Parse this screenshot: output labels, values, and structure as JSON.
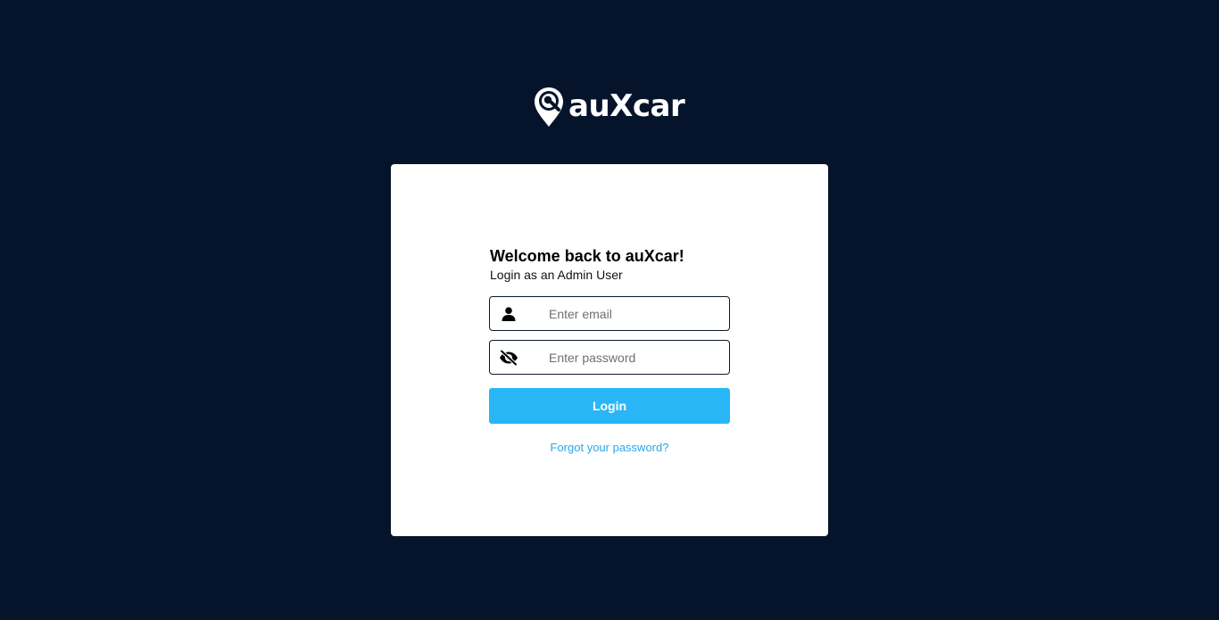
{
  "brand": {
    "name": "auXcar",
    "logo_icon": "location-pin-icon",
    "text_color": "#ffffff"
  },
  "login": {
    "title": "Welcome back to auXcar!",
    "subtitle": "Login as an Admin User",
    "email": {
      "icon": "user-icon",
      "placeholder": "Enter email",
      "value": ""
    },
    "password": {
      "icon": "eye-slash-icon",
      "placeholder": "Enter password",
      "value": ""
    },
    "button_label": "Login",
    "forgot_link": "Forgot your password?"
  },
  "colors": {
    "background": "#06142b",
    "card": "#ffffff",
    "accent": "#29b6f6",
    "link": "#29a8e8"
  }
}
